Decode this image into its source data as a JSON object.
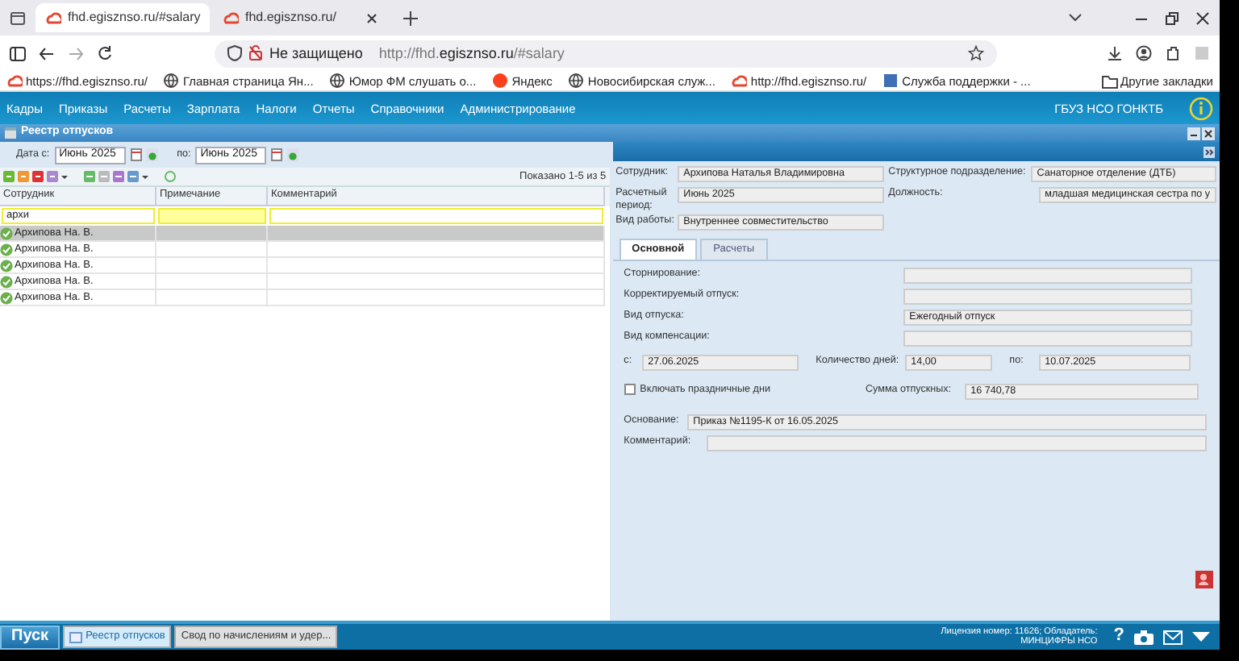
{
  "browser": {
    "tabs": [
      {
        "title": "fhd.egisznso.ru/#salary",
        "selected": true
      },
      {
        "title": "fhd.egisznso.ru/",
        "selected": false
      }
    ],
    "address": {
      "security": "Не защищено",
      "url_prefix": "http://fhd.",
      "url_domain": "egisznso.ru",
      "url_rest": "/#salary"
    },
    "bookmarks": [
      {
        "label": "https://fhd.egisznso.ru/",
        "kind": "cloud"
      },
      {
        "label": "Главная страница Ян...",
        "kind": "globe"
      },
      {
        "label": "Юмор ФМ слушать о...",
        "kind": "globe"
      },
      {
        "label": "Яндекс",
        "kind": "yandex"
      },
      {
        "label": "Новосибирская служ...",
        "kind": "globe"
      },
      {
        "label": "http://fhd.egisznso.ru/",
        "kind": "cloud"
      },
      {
        "label": "Служба поддержки - ...",
        "kind": "k"
      }
    ],
    "other_bookmarks": "Другие закладки"
  },
  "app": {
    "menu": [
      "Кадры",
      "Приказы",
      "Расчеты",
      "Зарплата",
      "Налоги",
      "Отчеты",
      "Справочники",
      "Администрирование"
    ],
    "organization": "ГБУЗ НСО ГОНКТБ",
    "window_title": "Реестр отпусков",
    "date_from": {
      "label": "Дата с:",
      "value": "Июнь 2025"
    },
    "date_to": {
      "label": "по:",
      "value": "Июнь 2025"
    },
    "paging": "Показано 1-5 из 5",
    "table": {
      "columns": [
        "Сотрудник",
        "Примечание",
        "Комментарий"
      ],
      "filters": [
        {
          "value": "архи",
          "highlighted": false
        },
        {
          "highlighted": true
        },
        {
          "highlighted": false
        }
      ],
      "rows": [
        {
          "employee": "Архипова На. В.",
          "selected": true
        },
        {
          "employee": "Архипова На. В.",
          "selected": false
        },
        {
          "employee": "Архипова На. В.",
          "selected": false
        },
        {
          "employee": "Архипова На. В.",
          "selected": false
        },
        {
          "employee": "Архипова На. В.",
          "selected": false
        }
      ]
    },
    "form": {
      "employee": {
        "label": "Сотрудник:",
        "value": "Архипова Наталья Владимировна"
      },
      "department": {
        "label": "Структурное подразделение:",
        "value": "Санаторное отделение (ДТБ)"
      },
      "period": {
        "label": "Расчетный период:",
        "value": "Июнь 2025"
      },
      "position": {
        "label": "Должность:",
        "value": "младшая медицинская сестра по у"
      },
      "work_type": {
        "label": "Вид работы:",
        "value": "Внутреннее совместительство"
      },
      "tabs": [
        {
          "label": "Основной",
          "selected": true
        },
        {
          "label": "Расчеты",
          "selected": false
        }
      ],
      "fields": [
        {
          "label": "Сторнирование:"
        },
        {
          "label": "Корректируемый отпуск:"
        },
        {
          "label": "Вид отпуска:",
          "value": "Ежегодный отпуск"
        },
        {
          "label": "Вид компенсации:"
        }
      ],
      "start": {
        "label": "с:",
        "value": "27.06.2025"
      },
      "days": {
        "label": "Количество дней:",
        "value": "14,00"
      },
      "end": {
        "label": "по:",
        "value": "10.07.2025"
      },
      "holidays": {
        "label": "Включать праздничные дни",
        "checked": false
      },
      "sum": {
        "label": "Сумма отпускных:",
        "value": "16 740,78"
      },
      "basis": {
        "label": "Основание:",
        "value": "Приказ №1195-К от 16.05.2025"
      },
      "comment": {
        "label": "Комментарий:"
      }
    }
  },
  "taskbar": {
    "start": "Пуск",
    "tasks": [
      {
        "label": "Реестр отпусков",
        "selected": true
      },
      {
        "label": "Свод по начислениям и удер...",
        "selected": false
      }
    ],
    "license": [
      "Лицензия номер: 11626; Обладатель:",
      "МИНЦИФРЫ НСО"
    ],
    "help": "?"
  }
}
